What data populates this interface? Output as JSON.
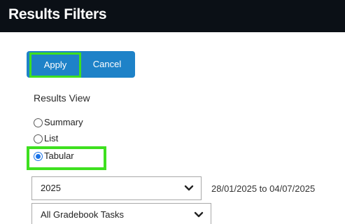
{
  "header": {
    "title": "Results Filters"
  },
  "actions": {
    "apply_label": "Apply",
    "cancel_label": "Cancel"
  },
  "results_view": {
    "label": "Results View",
    "options": [
      {
        "label": "Summary",
        "selected": false
      },
      {
        "label": "List",
        "selected": false
      },
      {
        "label": "Tabular",
        "selected": true
      }
    ]
  },
  "filters": {
    "year_value": "2025",
    "date_range": "28/01/2025 to 04/07/2025",
    "tasks_value": "All Gradebook Tasks"
  },
  "colors": {
    "header_bg": "#0b1016",
    "button_bg": "#1e82c8",
    "highlight": "#3ee01f",
    "radio_checked": "#1a73e8"
  },
  "icons": {
    "dropdown": "chevron-down-icon"
  }
}
